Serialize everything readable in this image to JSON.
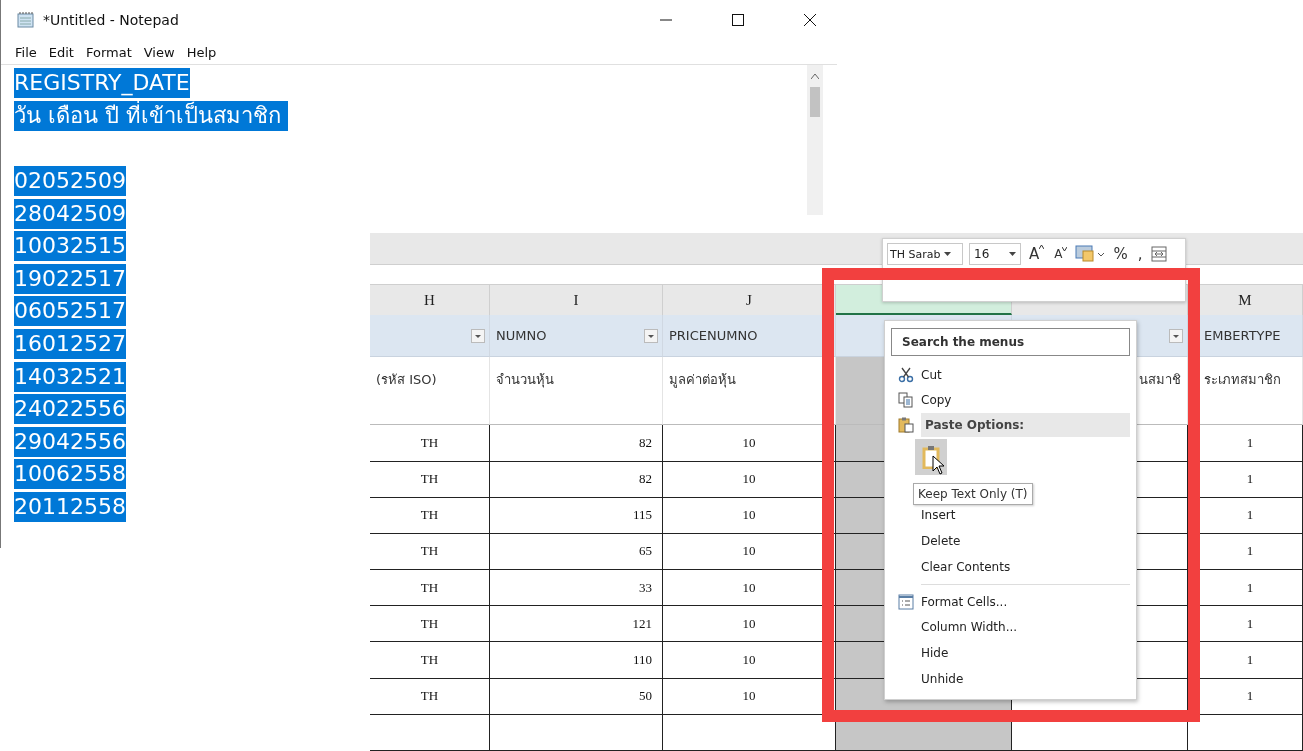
{
  "notepad": {
    "title": "*Untitled - Notepad",
    "menu": [
      "File",
      "Edit",
      "Format",
      "View",
      "Help"
    ],
    "lines": [
      {
        "kind": "text",
        "text": "REGISTRY_DATE",
        "selected": true
      },
      {
        "kind": "text",
        "text": "วัน เดือน ปี ที่เข้าเป็นสมาชิก ",
        "selected": true
      },
      {
        "kind": "blank"
      },
      {
        "kind": "text",
        "text": "02052509",
        "selected": true
      },
      {
        "kind": "text",
        "text": "28042509",
        "selected": true
      },
      {
        "kind": "text",
        "text": "10032515",
        "selected": true
      },
      {
        "kind": "text",
        "text": "19022517",
        "selected": true
      },
      {
        "kind": "text",
        "text": "06052517",
        "selected": true
      },
      {
        "kind": "text",
        "text": "16012527",
        "selected": true
      },
      {
        "kind": "text",
        "text": "14032521",
        "selected": true
      },
      {
        "kind": "text",
        "text": "24022556",
        "selected": true
      },
      {
        "kind": "text",
        "text": "29042556",
        "selected": true
      },
      {
        "kind": "text",
        "text": "10062558",
        "selected": true
      },
      {
        "kind": "text",
        "text": "20112558",
        "selected": true
      }
    ]
  },
  "spreadsheet": {
    "columns": [
      {
        "letter": "H",
        "selected": false
      },
      {
        "letter": "I",
        "selected": false
      },
      {
        "letter": "J",
        "selected": false
      },
      {
        "selected": true
      },
      {
        "selected": false
      },
      {
        "letter": "M",
        "selected": false
      }
    ],
    "rows": [
      {
        "kind": "header",
        "cells": [
          {
            "filter": true
          },
          {
            "text": "NUMNO",
            "filter": true
          },
          {
            "text": "PRICENUMNO"
          },
          {},
          {
            "filter": true
          },
          {
            "text": "EMBERTYPE"
          }
        ]
      },
      {
        "kind": "label",
        "cells": [
          {
            "text": "(รหัส ISO)"
          },
          {
            "text": "จำนวนหุ้น"
          },
          {
            "text": "มูลค่าต่อหุ้น"
          },
          {},
          {
            "text": "นสมาชิ"
          },
          {
            "text": "ระเภทสมาชิก"
          }
        ]
      },
      {
        "kind": "data",
        "cells": [
          {
            "text": "TH"
          },
          {
            "text": "82"
          },
          {
            "text": "10"
          },
          {},
          {},
          {
            "text": "1"
          }
        ]
      },
      {
        "kind": "data",
        "cells": [
          {
            "text": "TH"
          },
          {
            "text": "82"
          },
          {
            "text": "10"
          },
          {},
          {},
          {
            "text": "1"
          }
        ]
      },
      {
        "kind": "data",
        "cells": [
          {
            "text": "TH"
          },
          {
            "text": "115"
          },
          {
            "text": "10"
          },
          {},
          {},
          {
            "text": "1"
          }
        ]
      },
      {
        "kind": "data",
        "cells": [
          {
            "text": "TH"
          },
          {
            "text": "65"
          },
          {
            "text": "10"
          },
          {},
          {},
          {
            "text": "1"
          }
        ]
      },
      {
        "kind": "data",
        "cells": [
          {
            "text": "TH"
          },
          {
            "text": "33"
          },
          {
            "text": "10"
          },
          {},
          {},
          {
            "text": "1"
          }
        ]
      },
      {
        "kind": "data",
        "cells": [
          {
            "text": "TH"
          },
          {
            "text": "121"
          },
          {
            "text": "10"
          },
          {},
          {},
          {
            "text": "1"
          }
        ]
      },
      {
        "kind": "data",
        "cells": [
          {
            "text": "TH"
          },
          {
            "text": "110"
          },
          {
            "text": "10"
          },
          {},
          {},
          {
            "text": "1"
          }
        ]
      },
      {
        "kind": "data",
        "cells": [
          {
            "text": "TH"
          },
          {
            "text": "50"
          },
          {
            "text": "10"
          },
          {},
          {},
          {
            "text": "1"
          }
        ]
      },
      {
        "kind": "data",
        "cells": [
          {},
          {},
          {},
          {},
          {},
          {}
        ]
      }
    ]
  },
  "mini_toolbar": {
    "font": "TH Sarab",
    "size": "16",
    "buttons": [
      {
        "kind": "grow",
        "label": "A"
      },
      {
        "kind": "shrink",
        "label": "A"
      },
      {
        "kind": "fill"
      },
      {
        "kind": "text",
        "label": "%"
      },
      {
        "kind": "text",
        "label": ","
      },
      {
        "kind": "format"
      }
    ]
  },
  "context_menu": {
    "search": {
      "placeholder": "Search the menus"
    },
    "items": [
      {
        "kind": "item",
        "label": "Cut"
      },
      {
        "kind": "item",
        "label": "Copy"
      },
      {
        "kind": "header",
        "label": "Paste Options:"
      },
      {
        "kind": "paste",
        "selected": true
      },
      {
        "kind": "item",
        "label": "Insert"
      },
      {
        "kind": "item",
        "label": "Delete"
      },
      {
        "kind": "item",
        "label": "Clear Contents"
      },
      {
        "kind": "separator"
      },
      {
        "kind": "item",
        "label": "Format Cells..."
      },
      {
        "kind": "item",
        "label": "Column Width..."
      },
      {
        "kind": "item",
        "label": "Hide"
      },
      {
        "kind": "item",
        "label": "Unhide"
      }
    ]
  },
  "tooltip": "Keep Text Only (T)"
}
